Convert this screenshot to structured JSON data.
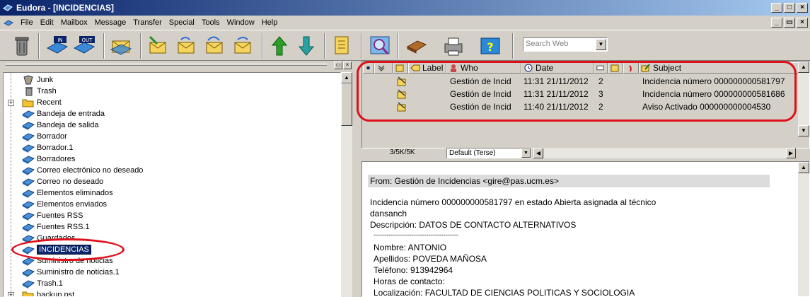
{
  "window": {
    "title": "Eudora - [INCIDENCIAS]",
    "min_glyph": "_",
    "max_glyph": "□",
    "close_glyph": "×",
    "restore_glyph": "▭"
  },
  "menu": [
    "File",
    "Edit",
    "Mailbox",
    "Message",
    "Transfer",
    "Special",
    "Tools",
    "Window",
    "Help"
  ],
  "toolbar": {
    "buttons": [
      {
        "icon": "trash-can-icon"
      },
      {
        "icon": "in-mailbox-icon",
        "tag": "IN"
      },
      {
        "icon": "out-mailbox-icon",
        "tag": "OUT"
      },
      {
        "icon": "check-mail-icon"
      },
      {
        "icon": "new-message-icon"
      },
      {
        "icon": "reply-icon"
      },
      {
        "icon": "reply-all-icon"
      },
      {
        "icon": "forward-icon"
      },
      {
        "icon": "previous-message-icon"
      },
      {
        "icon": "next-message-icon"
      },
      {
        "icon": "attach-icon"
      },
      {
        "icon": "find-icon"
      },
      {
        "icon": "address-book-icon"
      },
      {
        "icon": "print-icon"
      },
      {
        "icon": "help-icon"
      }
    ],
    "search_placeholder": "Search Web",
    "search_dropdown_glyph": "▼"
  },
  "tree": {
    "items": [
      {
        "label": "Junk",
        "icon": "junk-mailbox-icon"
      },
      {
        "label": "Trash",
        "icon": "trash-mailbox-icon"
      },
      {
        "label": "Recent",
        "icon": "folder-icon",
        "expander": "+"
      },
      {
        "label": "Bandeja de entrada",
        "icon": "mailbox-icon"
      },
      {
        "label": "Bandeja de salida",
        "icon": "mailbox-icon"
      },
      {
        "label": "Borrador",
        "icon": "mailbox-icon"
      },
      {
        "label": "Borrador.1",
        "icon": "mailbox-icon"
      },
      {
        "label": "Borradores",
        "icon": "mailbox-icon"
      },
      {
        "label": "Correo electrónico no deseado",
        "icon": "mailbox-icon"
      },
      {
        "label": "Correo no deseado",
        "icon": "mailbox-icon"
      },
      {
        "label": "Elementos eliminados",
        "icon": "mailbox-icon"
      },
      {
        "label": "Elementos enviados",
        "icon": "mailbox-icon"
      },
      {
        "label": "Fuentes RSS",
        "icon": "mailbox-icon"
      },
      {
        "label": "Fuentes RSS.1",
        "icon": "mailbox-icon"
      },
      {
        "label": "Guardados",
        "icon": "mailbox-icon"
      },
      {
        "label": "INCIDENCIAS",
        "icon": "mailbox-icon",
        "selected": true
      },
      {
        "label": "Suministro de noticias",
        "icon": "mailbox-icon"
      },
      {
        "label": "Suministro de noticias.1",
        "icon": "mailbox-icon"
      },
      {
        "label": "Trash.1",
        "icon": "mailbox-icon"
      },
      {
        "label": "backup.pst",
        "icon": "folder-icon",
        "expander": "+"
      }
    ]
  },
  "message_list": {
    "headers": [
      "Label",
      "Who",
      "Date",
      "Subject"
    ],
    "rows": [
      {
        "who": "Gestión de Incid",
        "date": "11:31 21/11/2012",
        "size": "2",
        "subject": "Incidencia número 000000000581797"
      },
      {
        "who": "Gestión de Incid",
        "date": "11:31 21/11/2012",
        "size": "3",
        "subject": "Incidencia número 000000000581686"
      },
      {
        "who": "Gestión de Incid",
        "date": "11:40 21/11/2012",
        "size": "2",
        "subject": "Aviso Activado 000000000004530"
      }
    ],
    "status_count": "3/5K/5K",
    "view_mode": "Default (Terse)"
  },
  "preview": {
    "from": "From: Gestión de Incidencias <gire@pas.ucm.es>",
    "lines": [
      "Incidencia número 000000000581797 en estado Abierta asignada al técnico",
      "dansanch",
      "Descripción: DATOS DE CONTACTO ALTERNATIVOS",
      "----------------------------------------",
      "Nombre: ANTONIO",
      "Apellidos: POVEDA MAÑOSA",
      "Teléfono: 913942964",
      "Horas de contacto:",
      "Localización: FACULTAD DE CIENCIAS POLITICAS Y SOCIOLOGIA"
    ]
  },
  "colors": {
    "annotation_red": "#e0101a",
    "titlebar_start": "#0a246a",
    "titlebar_end": "#a6caf0",
    "chrome": "#d4d0c8"
  }
}
